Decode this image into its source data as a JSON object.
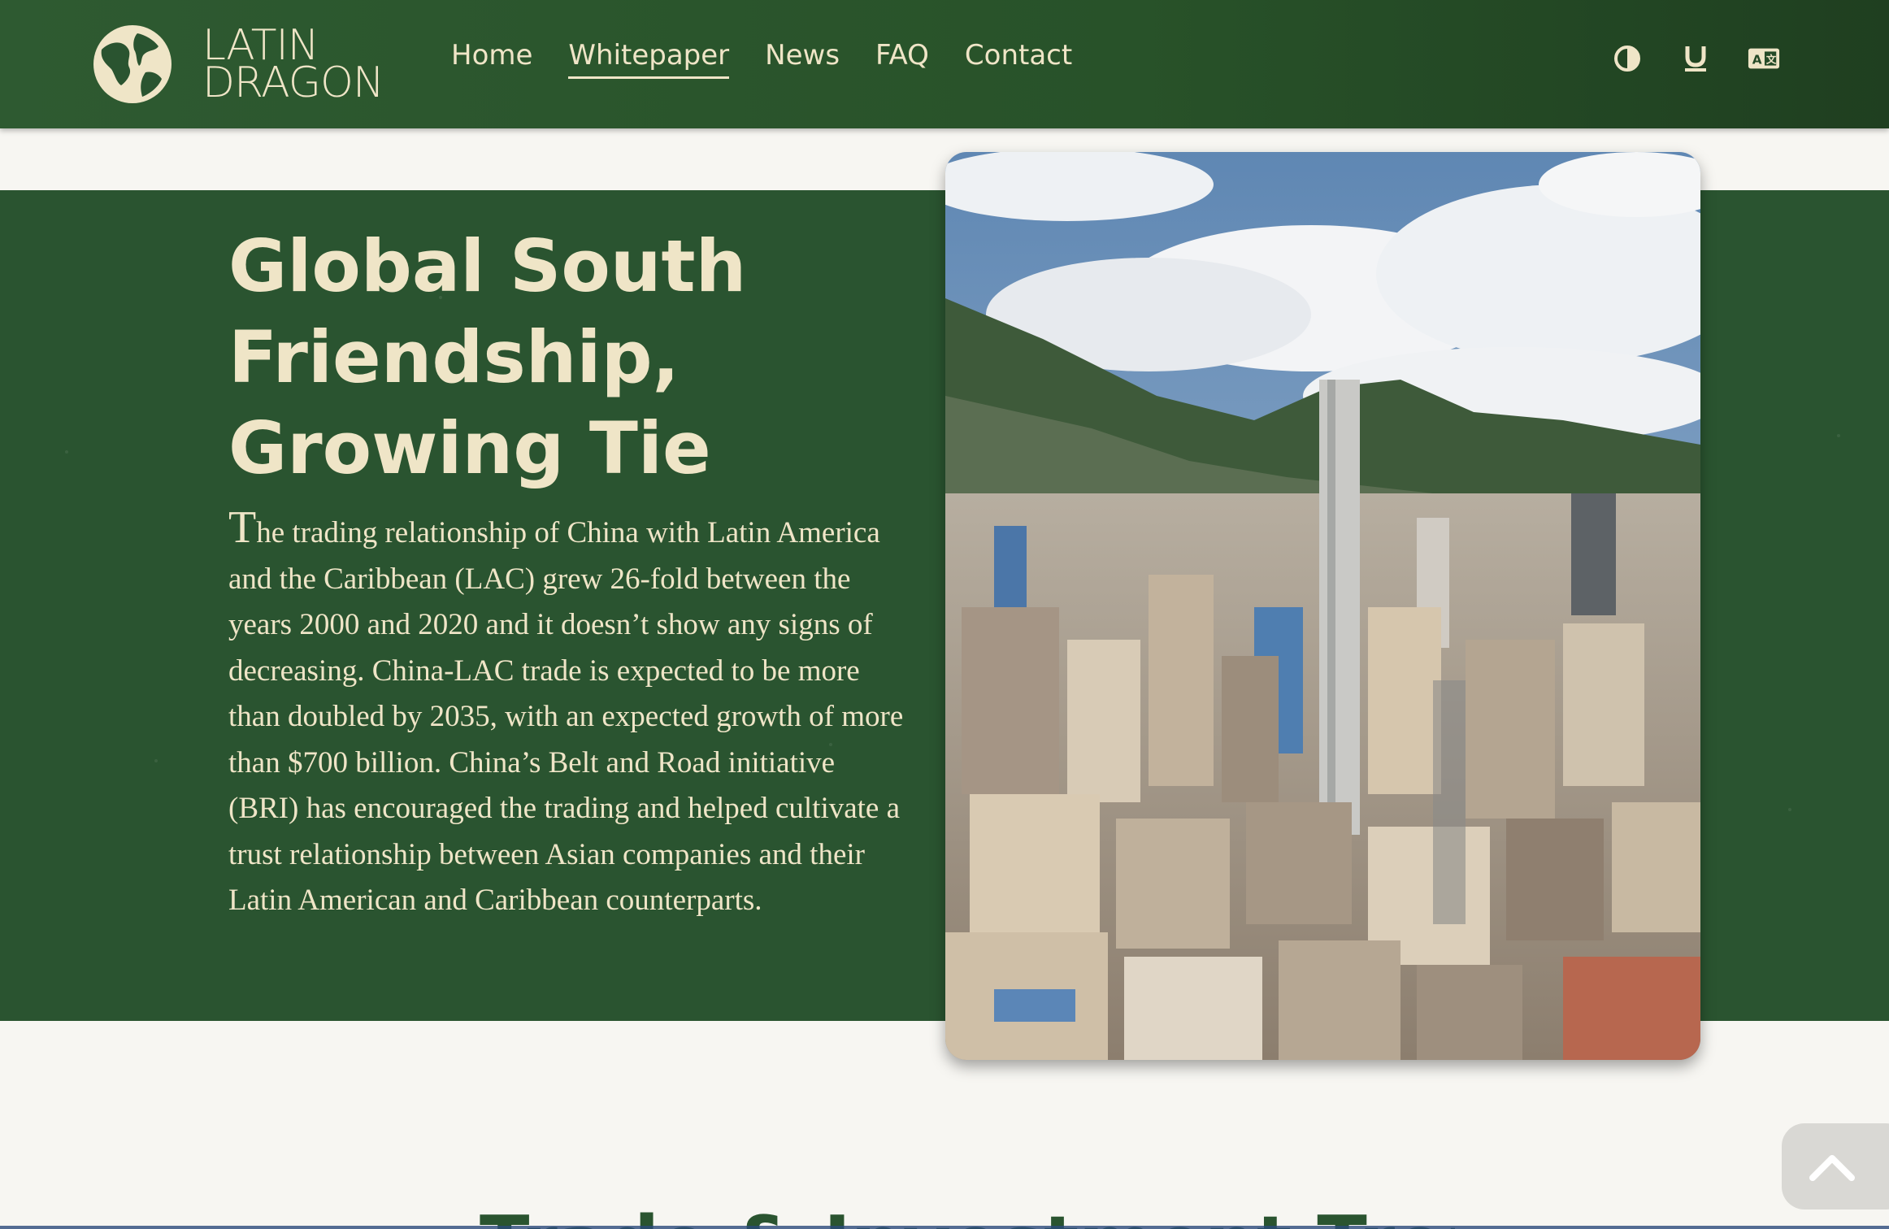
{
  "brand": {
    "line1": "LATIN",
    "line2": "DRAGON",
    "icon": "globe-icon"
  },
  "nav": [
    {
      "label": "Home",
      "active": false
    },
    {
      "label": "Whitepaper",
      "active": true
    },
    {
      "label": "News",
      "active": false
    },
    {
      "label": "FAQ",
      "active": false
    },
    {
      "label": "Contact",
      "active": false
    }
  ],
  "tools": [
    {
      "icon": "contrast-icon"
    },
    {
      "icon": "underline-icon"
    },
    {
      "icon": "translate-icon"
    }
  ],
  "hero": {
    "title": "Global South Friendship, Growing Tie",
    "dropcap": "T",
    "body": "he trading relationship of China with Latin America and the Caribbean (LAC) grew 26-fold between the years 2000 and 2020 and it doesn’t show any signs of decreasing. China-LAC trade is expected to be more than doubled by 2035, with an expected growth of more than $700 billion. China’s Belt and Road initiative (BRI) has encouraged the trading and helped cultivate a trust relationship between Asian companies and their Latin American and Caribbean counterparts."
  },
  "photo": {
    "alt": "city-skyline-photo"
  },
  "next_section": {
    "title": "Trade & Investment Trends"
  },
  "colors": {
    "green": "#2a5430",
    "cream": "#efe5c7",
    "background": "#f7f6f2"
  }
}
